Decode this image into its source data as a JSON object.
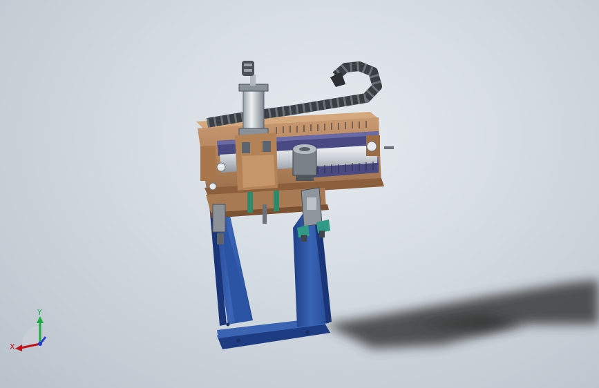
{
  "viewport": {
    "background_top": "#e6ebef",
    "background_bottom": "#b9c2cb"
  },
  "model": {
    "frame_color": "#3359a8",
    "plate_color": "#b4865f",
    "rail_color": "#4a4a82",
    "chain_color": "#3a3f44",
    "fixture_color": "#2f9a86"
  },
  "triad": {
    "x_label": "X",
    "y_label": "Y",
    "x_color": "#c0141a",
    "y_color": "#22a845",
    "z_color": "#2a3ad0",
    "icon": "coordinate-triad-icon"
  }
}
